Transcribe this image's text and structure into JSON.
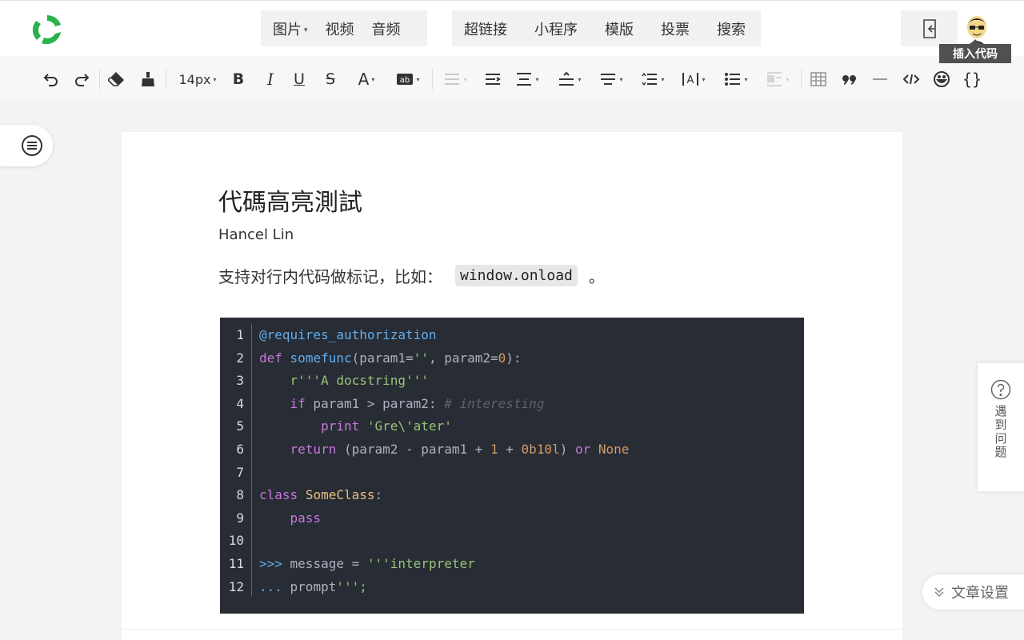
{
  "header": {
    "media_group": [
      {
        "label": "图片",
        "has_caret": true
      },
      {
        "label": "视频",
        "has_caret": false
      },
      {
        "label": "音频",
        "has_caret": false
      }
    ],
    "insert_group": [
      "超链接",
      "小程序",
      "模版",
      "投票",
      "搜索"
    ],
    "tooltip": "插入代码"
  },
  "toolbar": {
    "font_size": "14px"
  },
  "document": {
    "title": "代碼高亮測試",
    "author": "Hancel Lin",
    "paragraph_prefix": "支持对行内代码做标记，比如：",
    "inline_code": "window.onload",
    "paragraph_suffix": "。"
  },
  "code": {
    "line_numbers": [
      "1",
      "2",
      "3",
      "4",
      "5",
      "6",
      "7",
      "8",
      "9",
      "10",
      "11",
      "12"
    ],
    "lines": [
      "@requires_authorization",
      "def somefunc(param1='', param2=0):",
      "    r'''A docstring'''",
      "    if param1 > param2: # interesting",
      "        print 'Gre\\'ater'",
      "    return (param2 - param1 + 1 + 0b10l) or None",
      "",
      "class SomeClass:",
      "    pass",
      "",
      ">>> message = '''interpreter",
      "... prompt''';"
    ]
  },
  "help": {
    "label": "遇到问题"
  },
  "settings": {
    "label": "文章设置"
  },
  "colors": {
    "brand": "#2bb24c",
    "code_bg": "#282c34",
    "keyword": "#c678dd",
    "function": "#61aeee",
    "string": "#98c379",
    "number": "#d19a66"
  }
}
